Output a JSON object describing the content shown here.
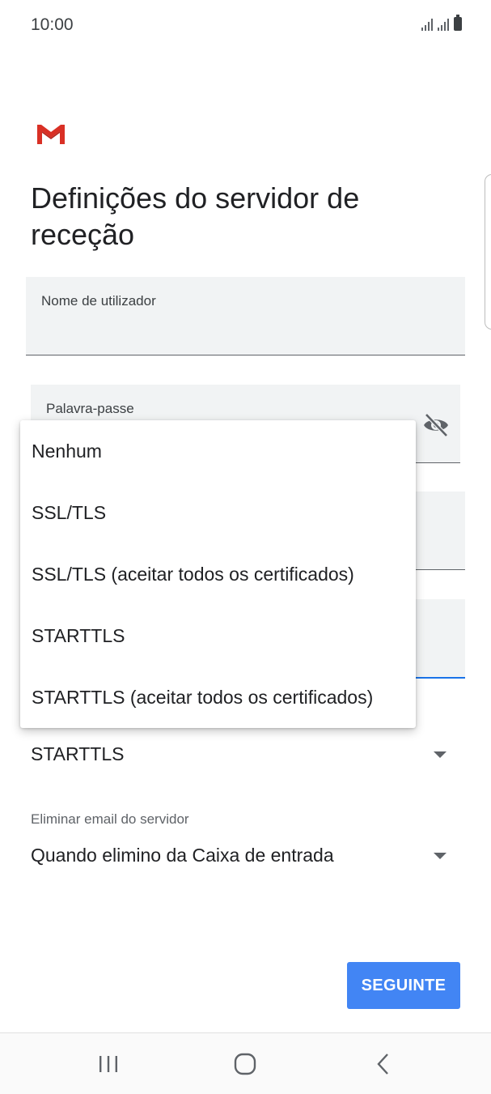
{
  "status_bar": {
    "time": "10:00"
  },
  "header": {
    "logo_icon": "gmail-icon",
    "title": "Definições do servidor de receção"
  },
  "form": {
    "username": {
      "label": "Nome de utilizador",
      "value": ""
    },
    "password": {
      "label": "Palavra-passe",
      "value": "",
      "toggle_icon": "visibility-off-icon"
    },
    "security_type": {
      "selected": "STARTTLS",
      "options": [
        "Nenhum",
        "SSL/TLS",
        "SSL/TLS (aceitar todos os certificados)",
        "STARTTLS",
        "STARTTLS (aceitar todos os certificados)"
      ]
    },
    "delete_email": {
      "label": "Eliminar email do servidor",
      "selected": "Quando elimino da Caixa de entrada"
    }
  },
  "actions": {
    "next_label": "SEGUINTE"
  },
  "nav_bar": {
    "recents_icon": "recents-icon",
    "home_icon": "home-icon",
    "back_icon": "back-icon"
  },
  "colors": {
    "accent": "#4285f4",
    "focus_underline": "#1a73e8",
    "gmail_red": "#d93025"
  }
}
